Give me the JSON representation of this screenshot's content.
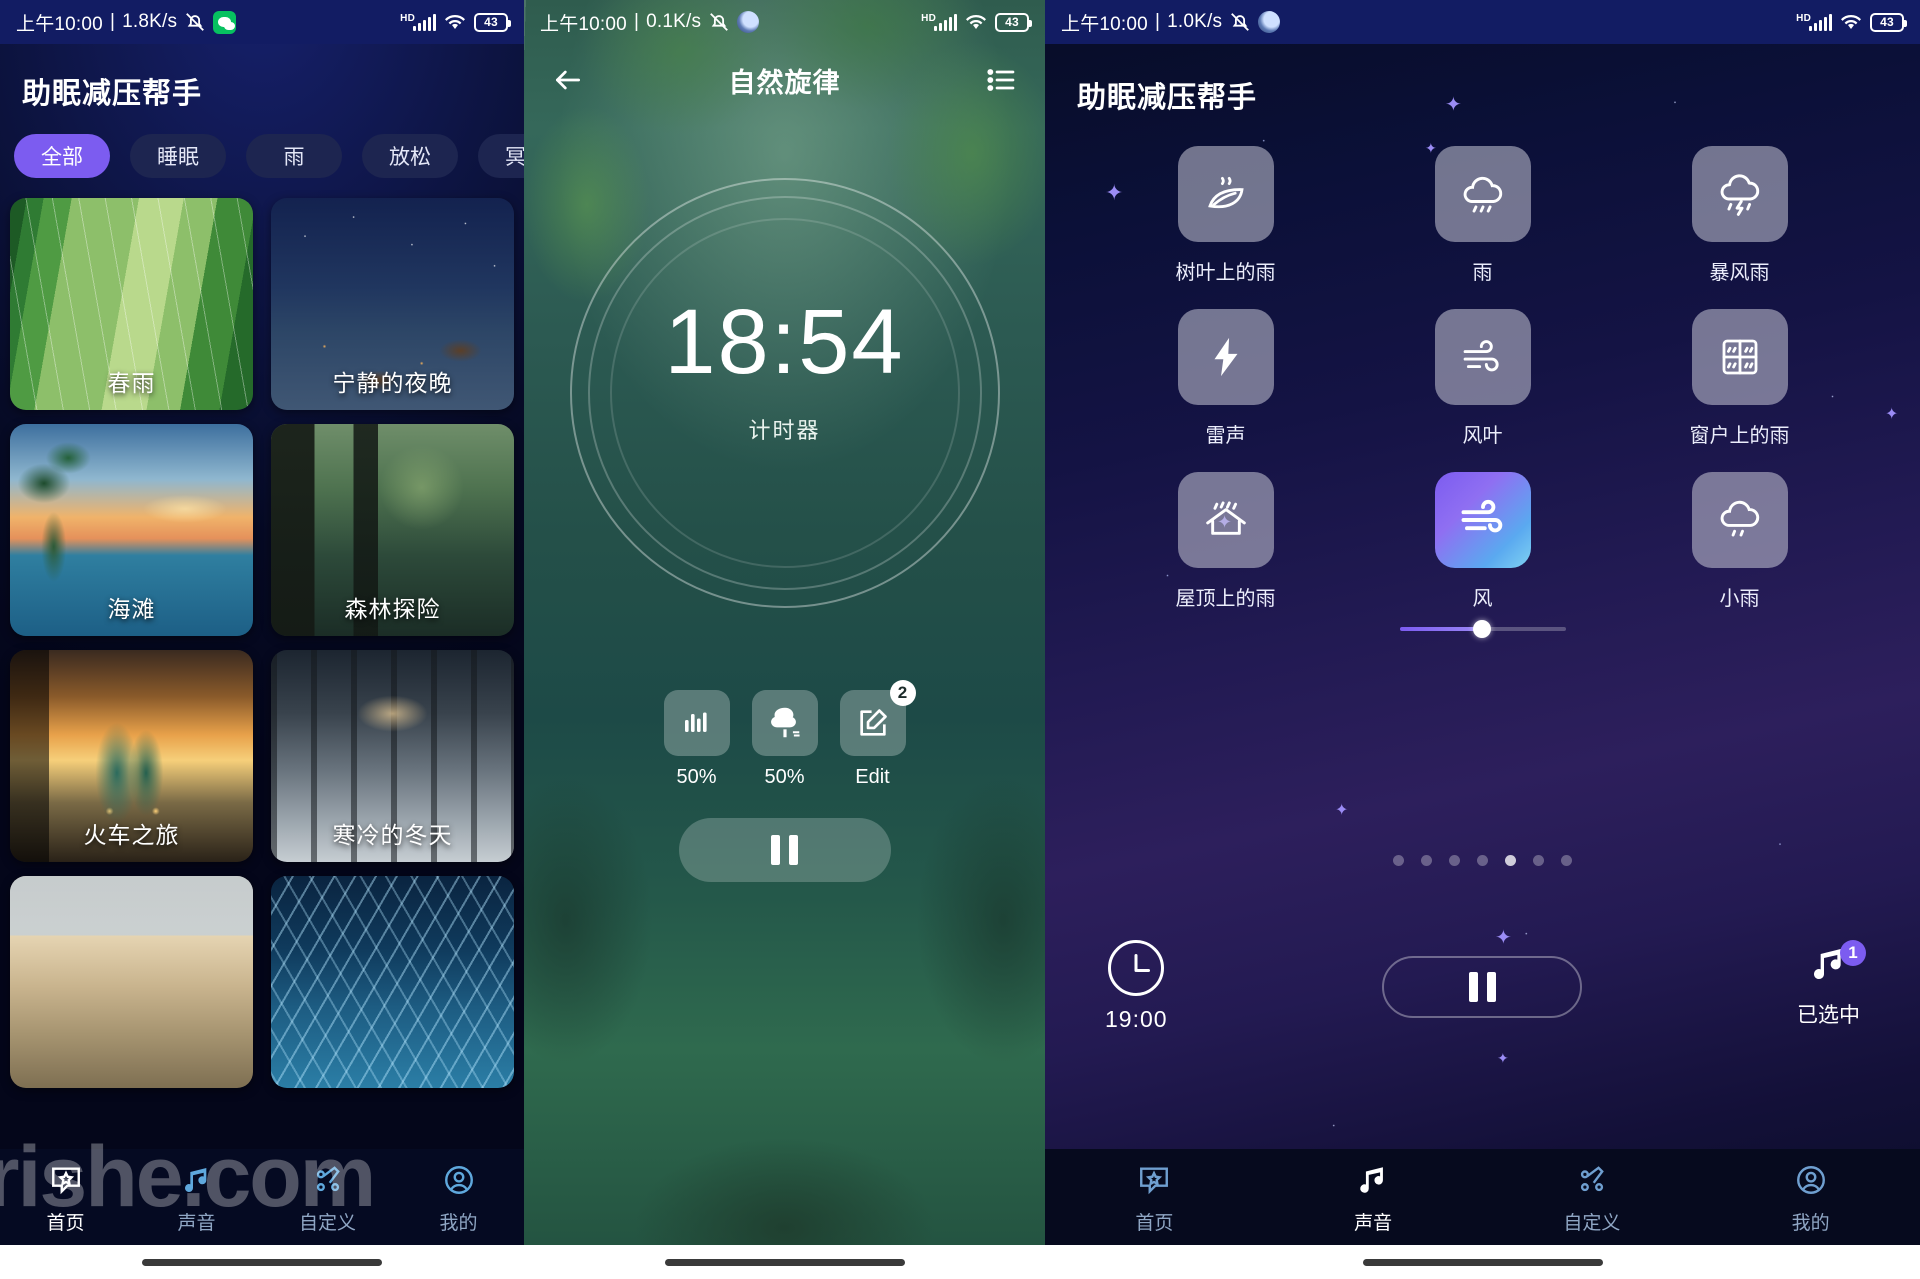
{
  "status_bar": {
    "p1": {
      "time": "上午10:00",
      "sep": "|",
      "net_speed": "1.8K/s",
      "battery": "43",
      "hd": "HD"
    },
    "p2": {
      "time": "上午10:00",
      "sep": "|",
      "net_speed": "0.1K/s",
      "battery": "43",
      "hd": "HD"
    },
    "p3": {
      "time": "上午10:00",
      "sep": "|",
      "net_speed": "1.0K/s",
      "battery": "43",
      "hd": "HD"
    }
  },
  "panel1": {
    "app_title": "助眠减压帮手",
    "chips": [
      {
        "label": "全部",
        "active": true
      },
      {
        "label": "睡眠",
        "active": false
      },
      {
        "label": "雨",
        "active": false
      },
      {
        "label": "放松",
        "active": false
      },
      {
        "label": "冥想",
        "active": false
      }
    ],
    "cards": [
      {
        "title": "春雨",
        "art": "art-bamboo"
      },
      {
        "title": "宁静的夜晚",
        "art": "art-night"
      },
      {
        "title": "海滩",
        "art": "art-beach"
      },
      {
        "title": "森林探险",
        "art": "art-forest"
      },
      {
        "title": "火车之旅",
        "art": "art-train"
      },
      {
        "title": "寒冷的冬天",
        "art": "art-winter"
      },
      {
        "title": "",
        "art": "art-field"
      },
      {
        "title": "",
        "art": "art-ice"
      }
    ],
    "nav": [
      {
        "label": "首页",
        "icon": "home-star-icon",
        "active": true
      },
      {
        "label": "声音",
        "icon": "music-note-icon",
        "active": false
      },
      {
        "label": "自定义",
        "icon": "customize-pencil-icon",
        "active": false
      },
      {
        "label": "我的",
        "icon": "profile-icon",
        "active": false
      }
    ],
    "watermark": "rishe.com"
  },
  "panel2": {
    "header_title": "自然旋律",
    "back_icon": "back-arrow-icon",
    "list_icon": "playlist-icon",
    "timer_value": "18:54",
    "timer_caption": "计时器",
    "controls": [
      {
        "icon": "equalizer-icon",
        "label": "50%",
        "badge": ""
      },
      {
        "icon": "tree-wind-icon",
        "label": "50%",
        "badge": ""
      },
      {
        "icon": "edit-icon",
        "label": "Edit",
        "badge": "2"
      }
    ],
    "play_state_icon": "pause-icon"
  },
  "panel3": {
    "app_title": "助眠减压帮手",
    "sounds": [
      {
        "label": "树叶上的雨",
        "icon": "leaf-rain-icon",
        "selected": false
      },
      {
        "label": "雨",
        "icon": "cloud-rain-icon",
        "selected": false
      },
      {
        "label": "暴风雨",
        "icon": "storm-icon",
        "selected": false
      },
      {
        "label": "雷声",
        "icon": "thunder-bolt-icon",
        "selected": false
      },
      {
        "label": "风叶",
        "icon": "wind-leaf-icon",
        "selected": false
      },
      {
        "label": "窗户上的雨",
        "icon": "window-rain-icon",
        "selected": false
      },
      {
        "label": "屋顶上的雨",
        "icon": "roof-rain-icon",
        "selected": false
      },
      {
        "label": "风",
        "icon": "wind-icon",
        "selected": true
      },
      {
        "label": "小雨",
        "icon": "drizzle-icon",
        "selected": false
      }
    ],
    "slider": {
      "value_percent": 46
    },
    "page_dots": {
      "count": 7,
      "active_index": 4
    },
    "timer_label": "19:00",
    "timer_icon": "clock-icon",
    "play_state_icon": "pause-icon",
    "selected_label": "已选中",
    "selected_count": "1",
    "selected_icon": "music-note-icon",
    "nav": [
      {
        "label": "首页",
        "icon": "home-star-icon",
        "active": false
      },
      {
        "label": "声音",
        "icon": "music-note-icon",
        "active": true
      },
      {
        "label": "自定义",
        "icon": "customize-pencil-icon",
        "active": false
      },
      {
        "label": "我的",
        "icon": "profile-icon",
        "active": false
      }
    ]
  },
  "colors": {
    "accent_violet": "#7c5cf0",
    "status_blue": "#121c63",
    "panel1_bg": "#0a0f2e",
    "panel3_bg": "#0b1038"
  }
}
